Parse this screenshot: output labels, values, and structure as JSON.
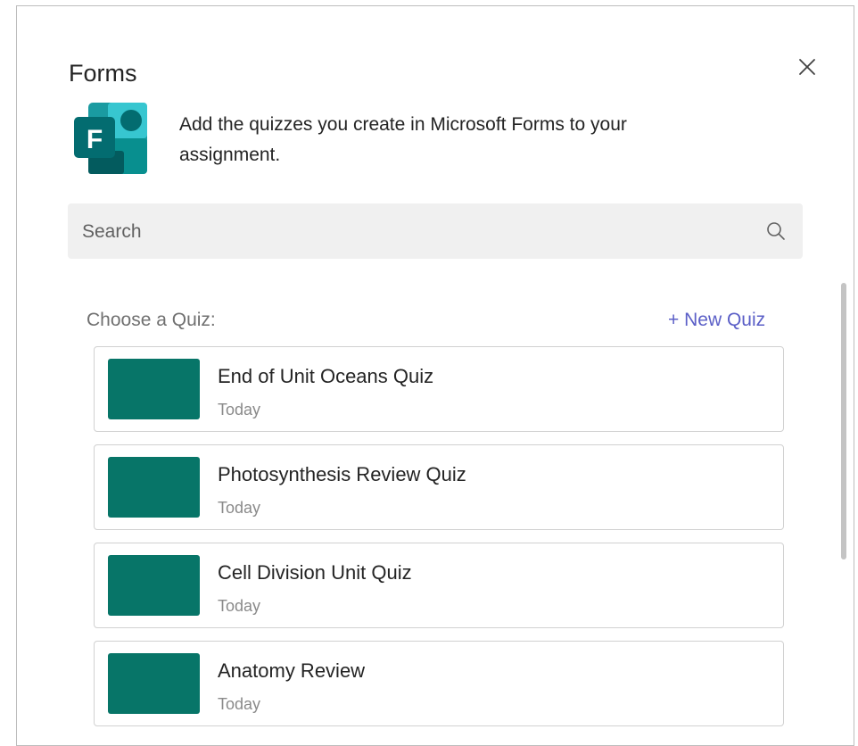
{
  "dialog": {
    "title": "Forms",
    "close_icon": "close-icon",
    "app_logo_letter": "F",
    "description": "Add the quizzes you create in Microsoft Forms to your assignment."
  },
  "search": {
    "placeholder": "Search",
    "value": "",
    "icon": "search-icon"
  },
  "quiz_section": {
    "label": "Choose a Quiz:",
    "new_quiz_label": "+ New Quiz",
    "items": [
      {
        "title": "End of Unit Oceans Quiz",
        "date": "Today"
      },
      {
        "title": "Photosynthesis Review Quiz",
        "date": "Today"
      },
      {
        "title": "Cell Division Unit Quiz",
        "date": "Today"
      },
      {
        "title": "Anatomy Review",
        "date": "Today"
      }
    ]
  },
  "colors": {
    "accent": "#5b5fc7",
    "thumbnail": "#077568",
    "forms_brand_dark": "#036c70",
    "forms_brand_light": "#37c6d0"
  }
}
